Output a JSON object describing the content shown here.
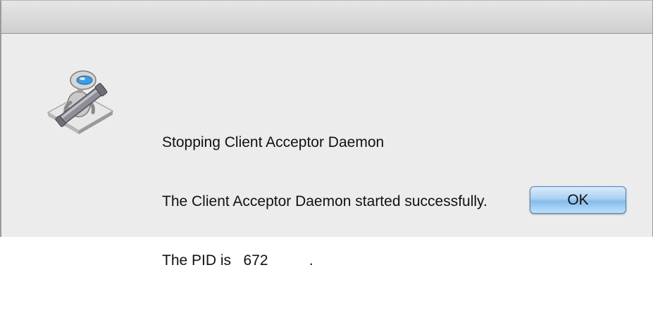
{
  "dialog": {
    "icon": "automator-robot-icon",
    "message_lines": [
      "Stopping Client Acceptor Daemon",
      "The Client Acceptor Daemon started successfully.",
      "The PID is   672          ."
    ],
    "ok_label": "OK"
  },
  "colors": {
    "button_blue": "#a9d1f4",
    "dialog_background": "#ececec"
  }
}
